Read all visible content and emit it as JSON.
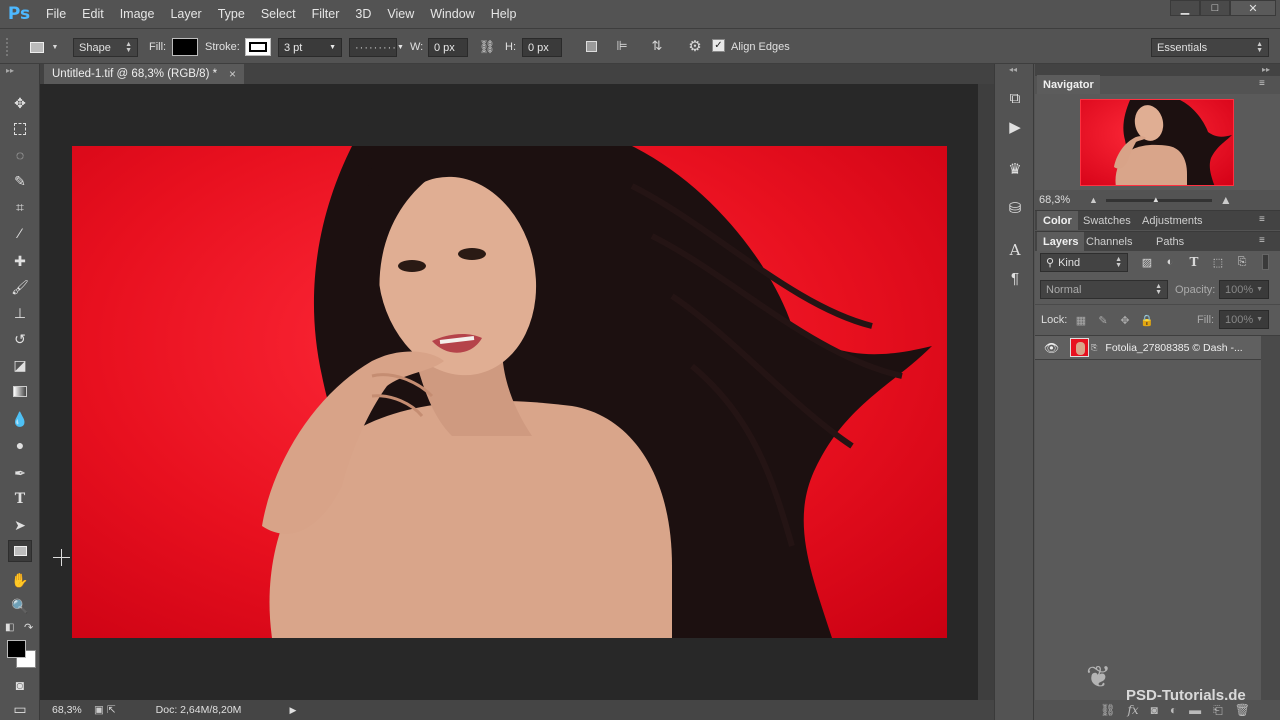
{
  "app": {
    "logo": "Ps"
  },
  "menu": [
    "File",
    "Edit",
    "Image",
    "Layer",
    "Type",
    "Select",
    "Filter",
    "3D",
    "View",
    "Window",
    "Help"
  ],
  "window_controls": {
    "minimize": "▁",
    "maximize": "□",
    "close": "✕"
  },
  "options": {
    "mode": "Shape",
    "fill_label": "Fill:",
    "stroke_label": "Stroke:",
    "stroke_width": "3 pt",
    "w_label": "W:",
    "w_value": "0 px",
    "h_label": "H:",
    "h_value": "0 px",
    "align_edges": "Align Edges",
    "workspace": "Essentials"
  },
  "document": {
    "tab_title": "Untitled-1.tif @ 68,3% (RGB/8) *",
    "close": "×"
  },
  "status": {
    "zoom": "68,3%",
    "doc": "Doc: 2,64M/8,20M"
  },
  "navigator": {
    "title": "Navigator",
    "zoom": "68,3%"
  },
  "panels": {
    "tabs_top": [
      "Color",
      "Swatches",
      "Adjustments"
    ],
    "tabs_layers": [
      "Layers",
      "Channels",
      "Paths"
    ],
    "kind": "Kind",
    "blend_mode": "Normal",
    "opacity_label": "Opacity:",
    "opacity_value": "100%",
    "lock_label": "Lock:",
    "fill_label": "Fill:",
    "fill_value": "100%"
  },
  "layers": [
    {
      "name": "Fotolia_27808385 © Dash -..."
    }
  ],
  "watermark": "PSD-Tutorials.de",
  "colors": {
    "canvas_red": "#e8101f",
    "panel_bg": "#535353",
    "accent_blue": "#4db8ff"
  }
}
